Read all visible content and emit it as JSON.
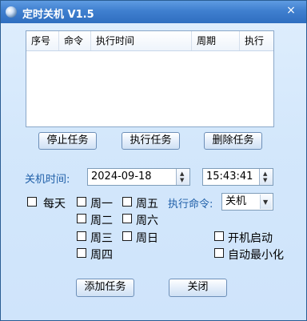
{
  "window": {
    "title": "定时关机 V1.5",
    "close_glyph": "×"
  },
  "task_list": {
    "columns": [
      "序号",
      "命令",
      "执行时间",
      "周期",
      "执行"
    ],
    "rows": []
  },
  "task_buttons": {
    "stop": "停止任务",
    "run": "执行任务",
    "delete": "删除任务"
  },
  "form": {
    "time_label": "关机时间:",
    "date_value": "2024-09-18",
    "time_value": "15:43:41",
    "daily_label": "每天",
    "weekdays": [
      "周一",
      "周二",
      "周三",
      "周四",
      "周五",
      "周六",
      "周日"
    ],
    "command_label": "执行命令:",
    "command_value": "关机",
    "startup_label": "开机启动",
    "minimize_label": "自动最小化"
  },
  "bottom_buttons": {
    "add": "添加任务",
    "close": "关闭"
  }
}
